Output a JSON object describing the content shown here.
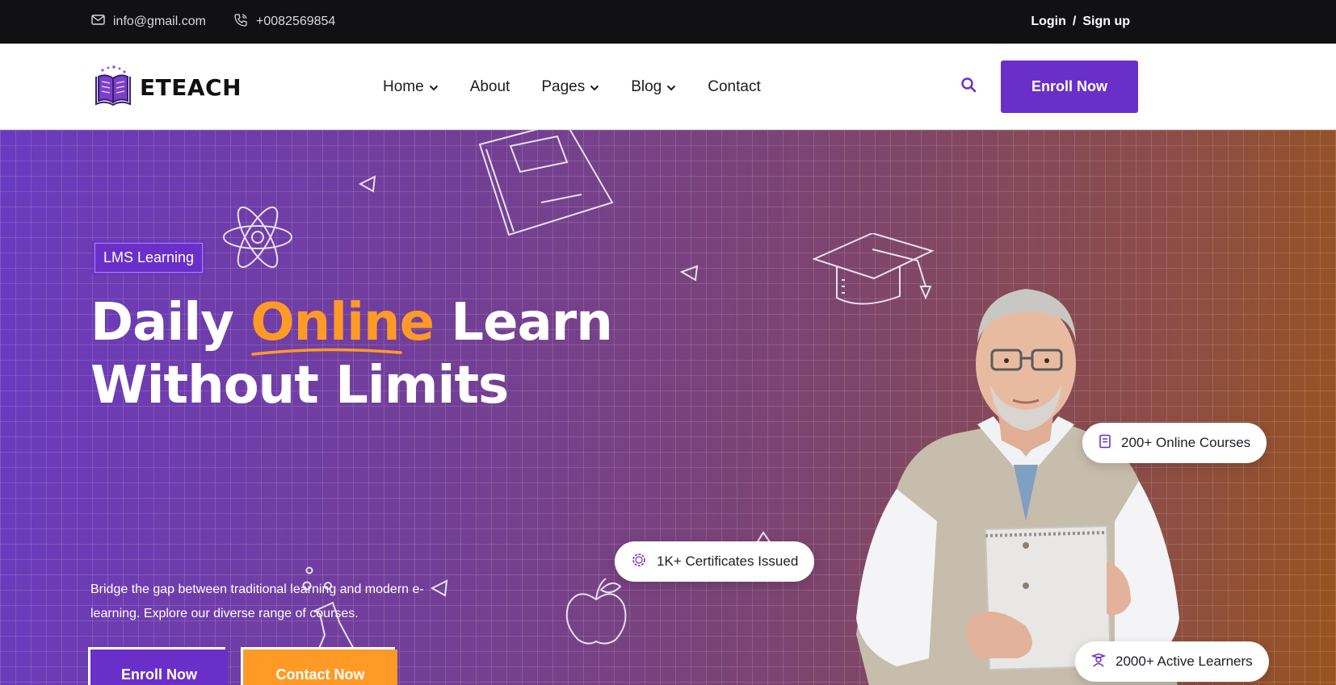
{
  "topbar": {
    "email": "info@gmail.com",
    "phone": "+0082569854",
    "login": "Login",
    "separator": "/",
    "signup": "Sign up",
    "icons": {
      "email": "mail-icon",
      "phone": "phone-icon"
    }
  },
  "header": {
    "logo_text": "ETEACH",
    "logo_icon": "book-logo-icon",
    "nav": [
      {
        "label": "Home",
        "dropdown": true
      },
      {
        "label": "About",
        "dropdown": false
      },
      {
        "label": "Pages",
        "dropdown": true
      },
      {
        "label": "Blog",
        "dropdown": true
      },
      {
        "label": "Contact",
        "dropdown": false
      }
    ],
    "search_icon": "search-icon",
    "enroll_label": "Enroll Now"
  },
  "hero": {
    "tag": "LMS Learning",
    "title_part1": "Daily ",
    "title_accent": "Online",
    "title_part2": " Learn",
    "title_line2": "Without Limits",
    "subtitle": "Bridge the gap between traditional learning and modern e-learning. Explore our diverse range of courses.",
    "enroll_label": "Enroll Now",
    "contact_label": "Contact Now",
    "stats": {
      "courses": "200+ Online Courses",
      "certificates": "1K+ Certificates Issued",
      "learners": "2000+ Active Learners"
    }
  },
  "colors": {
    "primary": "#6a2fc9",
    "accent": "#ff9a27",
    "topbar": "#111114"
  }
}
